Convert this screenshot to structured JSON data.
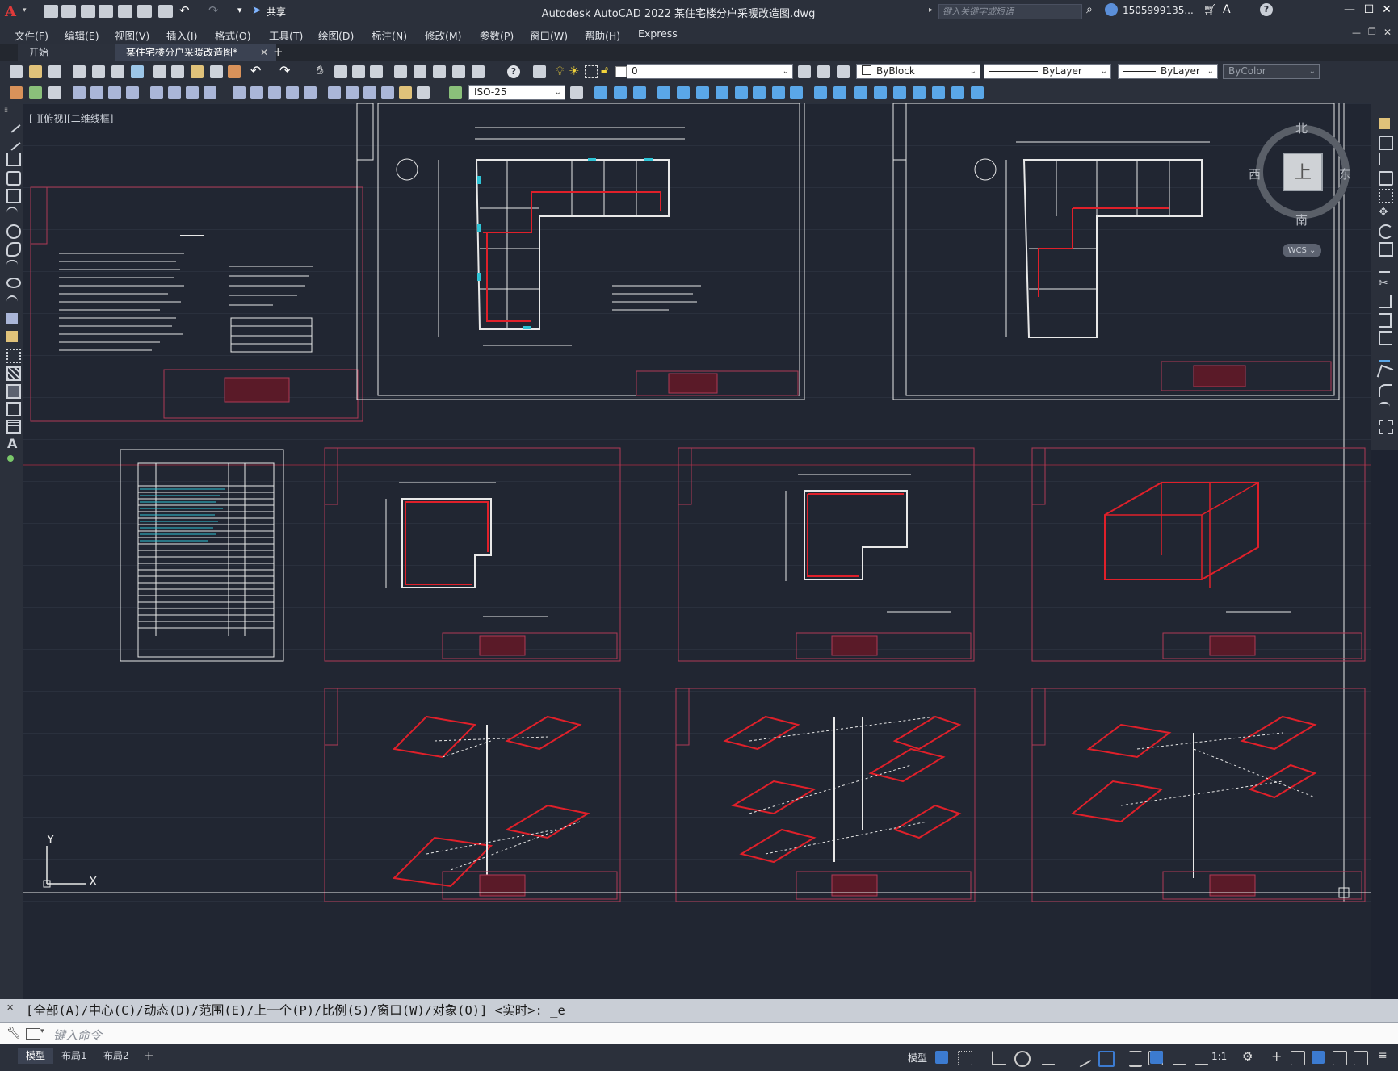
{
  "app": {
    "title": "Autodesk AutoCAD 2022    某住宅楼分户采暖改造图.dwg",
    "share_label": "共享",
    "search_placeholder": "键入关键字或短语",
    "user": "1505999135...",
    "logo": "A"
  },
  "menu": [
    "文件(F)",
    "编辑(E)",
    "视图(V)",
    "插入(I)",
    "格式(O)",
    "工具(T)",
    "绘图(D)",
    "标注(N)",
    "修改(M)",
    "参数(P)",
    "窗口(W)",
    "帮助(H)",
    "Express"
  ],
  "tabs": [
    {
      "label": "开始"
    },
    {
      "label": "某住宅楼分户采暖改造图*"
    }
  ],
  "toolbar": {
    "layer_value": "0",
    "color_value": "ByBlock",
    "linetype_value": "ByLayer",
    "lineweight_value": "ByLayer",
    "plotstyle_value": "ByColor",
    "dimstyle_value": "ISO-25"
  },
  "viewport_label": "[-][俯视][二维线框]",
  "viewcube": {
    "face": "上",
    "north": "北",
    "south": "南",
    "east": "东",
    "west": "西",
    "wcs": "WCS"
  },
  "ucs": {
    "x": "X",
    "y": "Y"
  },
  "command": {
    "history": "[全部(A)/中心(C)/动态(D)/范围(E)/上一个(P)/比例(S)/窗口(W)/对象(O)] <实时>: _e",
    "placeholder": "键入命令"
  },
  "layout_tabs": [
    "模型",
    "布局1",
    "布局2"
  ],
  "status": {
    "model": "模型",
    "scale": "1:1"
  },
  "colors": {
    "canvas": "#212632",
    "frame_red": "#b03a55",
    "pipe_red": "#e0202a",
    "accent_cyan": "#2ec4d6"
  }
}
